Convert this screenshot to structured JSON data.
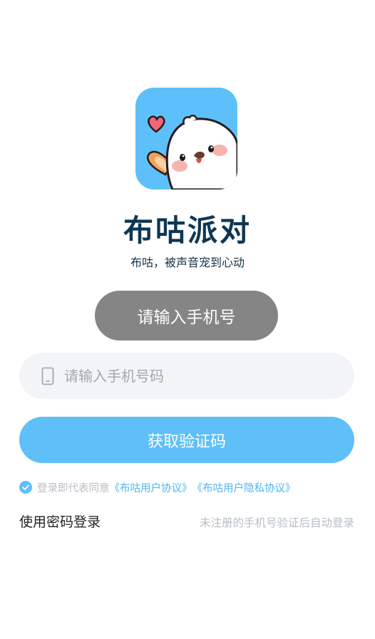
{
  "app": {
    "name": "布咕派对",
    "slogan": "布咕，被声音宠到心动"
  },
  "toast": {
    "message": "请输入手机号"
  },
  "phone_field": {
    "value": "",
    "placeholder": "请输入手机号码"
  },
  "get_code_button": {
    "label": "获取验证码"
  },
  "agreement": {
    "checked": true,
    "prefix": "登录即代表同意",
    "user_agreement": "《布咕用户协议》",
    "privacy_agreement": "《布咕用户隐私协议》"
  },
  "footer": {
    "password_login": "使用密码登录",
    "auto_register_note": "未注册的手机号验证后自动登录"
  },
  "colors": {
    "brand_blue": "#5fc0f9",
    "link_blue": "#4cb5f4",
    "toast_gray": "#858585",
    "title_navy": "#0e3654"
  },
  "icons": {
    "logo": "chick-mascot-logo",
    "phone": "phone-icon",
    "check": "check-circle-icon",
    "heart": "heart-icon"
  }
}
